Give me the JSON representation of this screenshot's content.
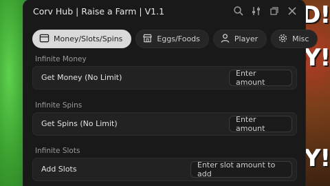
{
  "window": {
    "title": "Corv Hub | Raise a Farm | V1.1",
    "icons": [
      "search-icon",
      "settings-sliders-icon",
      "minimize-icon",
      "close-icon"
    ]
  },
  "background": {
    "banner_lines": [
      "D!",
      "DY!",
      "DY!"
    ]
  },
  "tabs": [
    {
      "label": "Money/Slots/Spins",
      "icon": "window-icon",
      "active": true
    },
    {
      "label": "Eggs/Foods",
      "icon": "store-icon",
      "active": false
    },
    {
      "label": "Player",
      "icon": "user-icon",
      "active": false
    },
    {
      "label": "Misc",
      "icon": "gear-icon",
      "active": false
    }
  ],
  "sections": [
    {
      "header": "Infinite Money",
      "row_label": "Get Money (No Limit)",
      "input_placeholder": "Enter amount"
    },
    {
      "header": "Infinite Spins",
      "row_label": "Get Spins (No Limit)",
      "input_placeholder": "Enter amount"
    },
    {
      "header": "Infinite Slots",
      "row_label": "Add Slots",
      "input_placeholder": "Enter slot amount to add"
    }
  ],
  "colors": {
    "panel": "#191919",
    "active_tab": "#d9d9d9",
    "row": "#222222"
  }
}
